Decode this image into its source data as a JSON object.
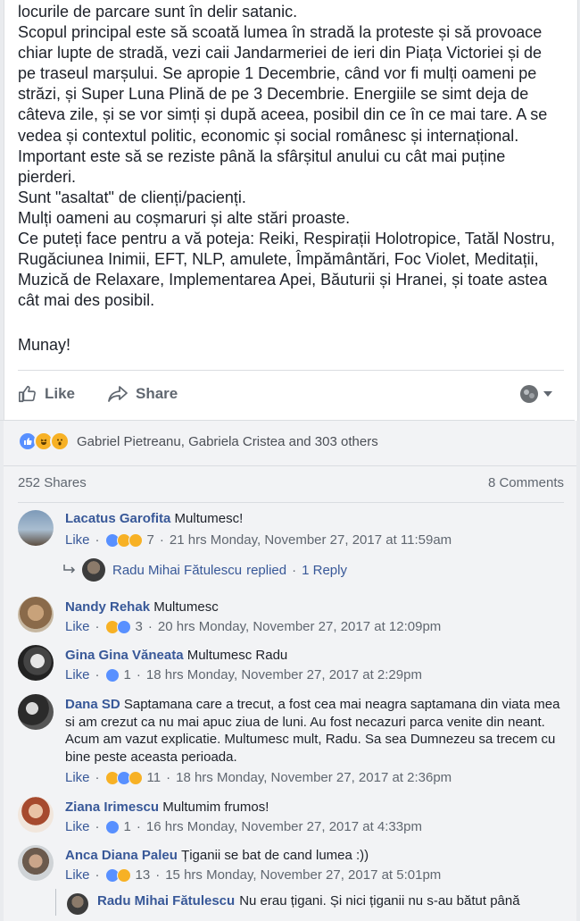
{
  "post": {
    "lines": [
      "locurile de parcare sunt în delir satanic.",
      "Scopul principal este să scoată lumea în stradă la proteste și să provoace",
      "chiar lupte de stradă, vezi caii Jandarmeriei de ieri din Piața Victoriei și de",
      "pe traseul marșului. Se apropie 1 Decembrie, când vor fi mulți oameni pe",
      "străzi, și Super Luna Plină de pe 3 Decembrie. Energiile se simt deja de",
      "câteva zile, și se vor simți și după aceea, posibil din ce în ce mai tare. A se",
      "vedea și contextul politic, economic și social românesc și internațional.",
      "Important este să se reziste până la sfârșitul anului cu cât mai puține",
      "pierderi.",
      "Sunt \"asaltat\" de clienți/pacienți.",
      "Mulți oameni au coșmaruri și alte stări proaste.",
      "Ce puteți face pentru a vă poteja: Reiki, Respirații Holotropice, Tatăl Nostru,",
      "Rugăciunea Inimii, EFT, NLP, amulete, Împământări, Foc Violet, Meditații,",
      "Muzică de Relaxare, Implementarea Apei, Băuturii și Hranei, și toate astea",
      "cât mai des posibil."
    ],
    "signature": "Munay!"
  },
  "actions": {
    "like": "Like",
    "share": "Share"
  },
  "reactions": {
    "names": "Gabriel Pietreanu, Gabriela Cristea and 303 others"
  },
  "stats": {
    "shares": "252 Shares",
    "comments": "8 Comments"
  },
  "comments": [
    {
      "name": "Lacatus Garofita",
      "text": "Multumesc!",
      "like": "Like",
      "count": "7",
      "time": "21 hrs Monday, November 27, 2017 at 11:59am"
    },
    {
      "name": "Nandy Rehak",
      "text": "Multumesc",
      "like": "Like",
      "count": "3",
      "time": "20 hrs Monday, November 27, 2017 at 12:09pm"
    },
    {
      "name": "Gina Gina Văneata",
      "text": "Multumesc Radu",
      "like": "Like",
      "count": "1",
      "time": "18 hrs Monday, November 27, 2017 at 2:29pm"
    },
    {
      "name": "Dana SD",
      "text": "Saptamana care a trecut, a fost cea mai neagra saptamana din viata mea si am crezut ca nu mai apuc ziua de luni. Au fost necazuri parca venite din neant. Acum am vazut explicatie. Multumesc mult, Radu. Sa sea Dumnezeu sa trecem cu bine peste aceasta perioada.",
      "like": "Like",
      "count": "11",
      "time": "18 hrs Monday, November 27, 2017 at 2:36pm"
    },
    {
      "name": "Ziana Irimescu",
      "text": "Multumim frumos!",
      "like": "Like",
      "count": "1",
      "time": "16 hrs Monday, November 27, 2017 at 4:33pm"
    },
    {
      "name": "Anca Diana Paleu",
      "text": "Țiganii se bat de cand lumea :))",
      "like": "Like",
      "count": "13",
      "time": "15 hrs Monday, November 27, 2017 at 5:01pm"
    }
  ],
  "reply": {
    "name": "Radu Mihai Fătulescu",
    "action": "replied",
    "sep": "·",
    "count": "1 Reply"
  },
  "nested": {
    "name": "Radu Mihai Fătulescu",
    "text": "Nu erau țigani. Și nici țiganii nu s-au bătut până"
  },
  "colors": {
    "link": "#385898",
    "like_blue": "#5890ff",
    "muted": "#606770",
    "bg": "#f2f3f5"
  }
}
